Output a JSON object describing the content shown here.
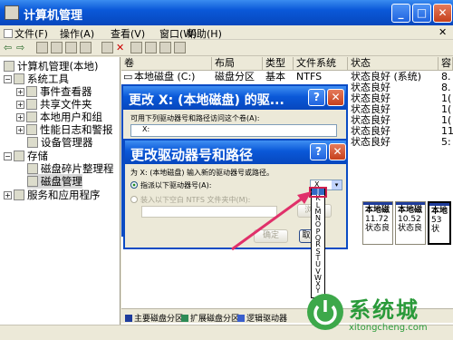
{
  "window": {
    "title": "计算机管理"
  },
  "menu": [
    "文件(F)",
    "操作(A)",
    "查看(V)",
    "窗口(W)",
    "帮助(H)"
  ],
  "tree": {
    "root": "计算机管理(本地)",
    "system_tools": "系统工具",
    "event_viewer": "事件查看器",
    "shared_folders": "共享文件夹",
    "local_users": "本地用户和组",
    "perf_logs": "性能日志和警报",
    "device_manager": "设备管理器",
    "storage": "存储",
    "defrag": "磁盘碎片整理程",
    "disk_mgmt": "磁盘管理",
    "services": "服务和应用程序"
  },
  "columns": [
    "卷",
    "布局",
    "类型",
    "文件系统",
    "状态",
    "容"
  ],
  "rows": [
    {
      "vol": "本地磁盘 (C:)",
      "layout": "磁盘分区",
      "type": "基本",
      "fs": "NTFS",
      "status": "状态良好 (系统)",
      "cap": "8."
    },
    {
      "status": "状态良好",
      "cap": "8."
    },
    {
      "status": "状态良好",
      "cap": "1("
    },
    {
      "status": "状态良好",
      "cap": "1("
    },
    {
      "status": "状态良好",
      "cap": "1("
    },
    {
      "status": "状态良好",
      "cap": "11"
    },
    {
      "status": "状态良好",
      "cap": "5:"
    }
  ],
  "back_dialog": {
    "title": "更改 X: (本地磁盘) 的驱...",
    "text": "可用下列驱动器号和路径访问这个卷(A):",
    "entry": "X:"
  },
  "front_dialog": {
    "title": "更改驱动器号和路径",
    "desc": "为 X: (本地磁盘) 输入新的驱动器号或路径。",
    "opt_letter": "指派以下驱动器号(A):",
    "opt_path": "装入以下空白 NTFS 文件夹中(M):",
    "browse": "浏览(",
    "ok": "确定",
    "cancel": "取",
    "selected_letter": "X",
    "dropdown_letters": [
      "J",
      "K",
      "L",
      "M",
      "N",
      "O",
      "P",
      "Q",
      "R",
      "S",
      "T",
      "U",
      "V",
      "W",
      "X",
      "Y"
    ]
  },
  "disks": [
    {
      "title": "本地磁",
      "size": "11.72",
      "status": "状态良"
    },
    {
      "title": "本地磁",
      "size": "10.52",
      "status": "状态良"
    },
    {
      "title": "本地",
      "size": "53",
      "status": "状"
    }
  ],
  "legend": [
    "主要磁盘分区",
    "扩展磁盘分区",
    "逻辑驱动器"
  ],
  "colors": {
    "primary": "#1e3c9c",
    "extended": "#2e8b57",
    "logical": "#3a5fcd",
    "arrow": "#e0306a"
  },
  "watermark": {
    "brand": "系统城",
    "url": "xitongcheng.com"
  }
}
